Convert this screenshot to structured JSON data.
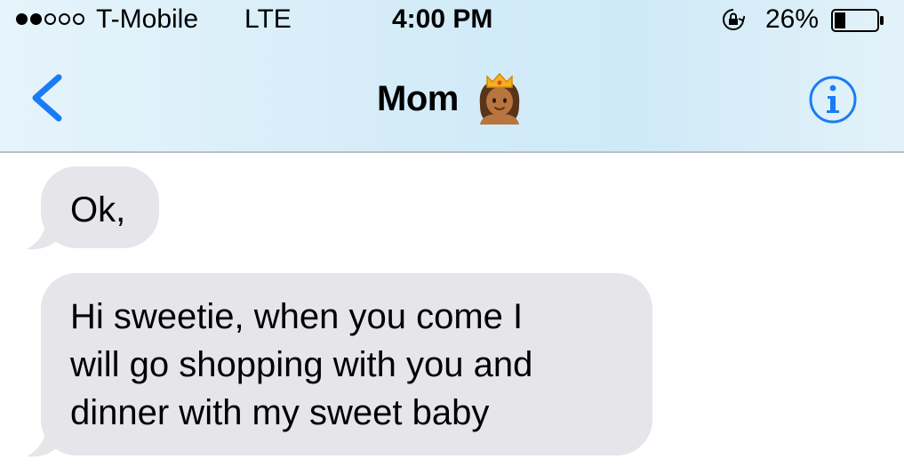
{
  "status_bar": {
    "signal_bars_filled": 2,
    "signal_bars_total": 5,
    "carrier": "T-Mobile",
    "network": "LTE",
    "time": "4:00 PM",
    "battery_percent": "26%",
    "battery_level": 0.26
  },
  "nav": {
    "back_icon": "chevron-left-icon",
    "contact_name": "Mom",
    "contact_emoji": "princess-emoji",
    "info_icon": "info-icon"
  },
  "messages": [
    {
      "direction": "received",
      "lines": [
        "Ok,"
      ]
    },
    {
      "direction": "received",
      "lines": [
        "Hi sweetie, when you come I",
        "will go shopping with you and",
        "dinner with my sweet baby"
      ]
    }
  ],
  "colors": {
    "accent": "#1a7cf5",
    "bubble_received": "#e5e5ea",
    "header_tint": "#d4ecf8"
  }
}
